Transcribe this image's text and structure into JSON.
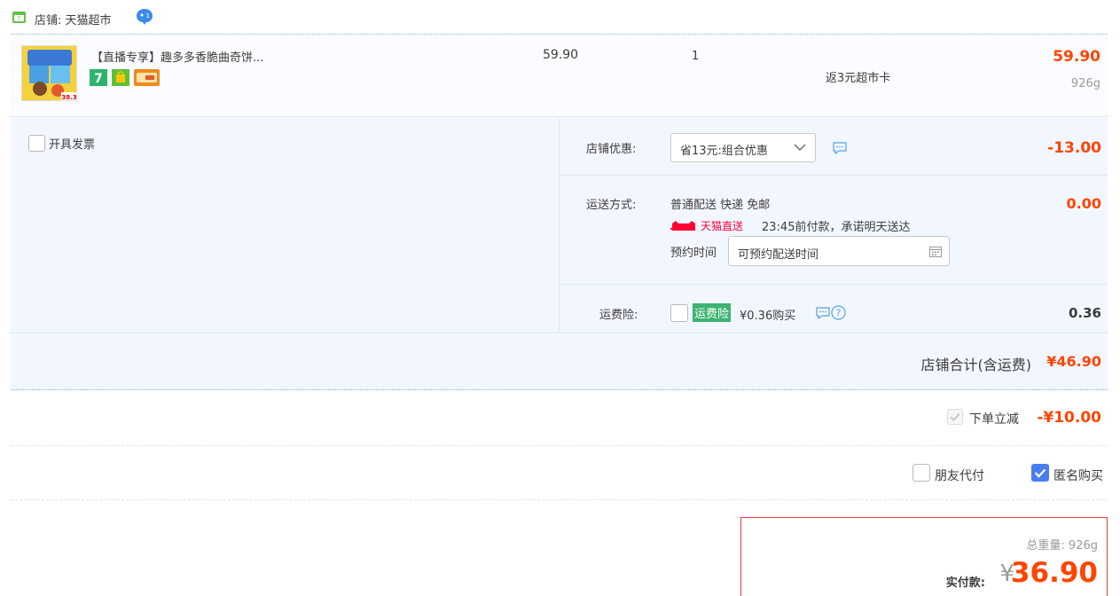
{
  "shop": {
    "label": "店铺: 天猫超市",
    "wangwang_count": "1"
  },
  "item": {
    "title": "【直播专享】趣多多香脆曲奇饼...",
    "thumb_text": "38.3",
    "price": "59.90",
    "quantity": "1",
    "rebate": "返3元超市卡",
    "subtotal": "59.90",
    "weight": "926g",
    "badges": [
      "7",
      "gift",
      "card"
    ]
  },
  "invoice": {
    "label": "开具发票",
    "checked": false
  },
  "shop_discount": {
    "label": "店铺优惠:",
    "selected": "省13元:组合优惠",
    "amount": "-13.00"
  },
  "shipping": {
    "label": "运送方式:",
    "method": "普通配送 快递 免邮",
    "direct_badge": "天猫直送",
    "promise": "23:45前付款，承诺明天送达",
    "schedule_label": "预约时间",
    "schedule_placeholder": "可预约配送时间",
    "amount": "0.00"
  },
  "insurance": {
    "label": "运费险:",
    "tag": "运费险",
    "price_text": "¥0.36购买",
    "amount": "0.36",
    "checked": false
  },
  "shop_total": {
    "label": "店铺合计(含运费)",
    "amount": "¥46.90"
  },
  "order_discount": {
    "label": "下单立减",
    "amount": "-¥10.00",
    "checked": true
  },
  "pay_options": {
    "friend_pay": "朋友代付",
    "friend_checked": false,
    "anonymous": "匿名购买",
    "anonymous_checked": true
  },
  "final": {
    "total_weight": "总重量:  926g",
    "pay_label": "实付款:",
    "currency": "¥",
    "amount": "36.90"
  },
  "colors": {
    "price_red": "#ff4400",
    "blue_bg": "#f2f7ff",
    "checkbox_blue": "#4a7df0",
    "insurance_green": "#3cb371",
    "frame_red": "#e4393c"
  }
}
